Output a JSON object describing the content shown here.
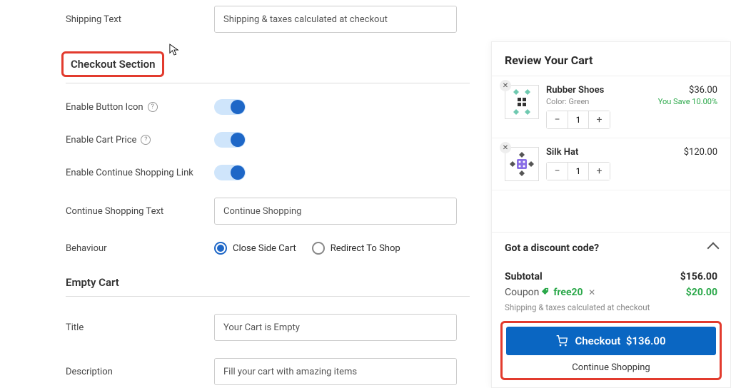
{
  "form": {
    "shipping_text_label": "Shipping Text",
    "shipping_text_value": "Shipping & taxes calculated at checkout",
    "checkout_section_heading": "Checkout Section",
    "enable_button_icon_label": "Enable Button Icon",
    "enable_cart_price_label": "Enable Cart Price",
    "enable_continue_shopping_label": "Enable Continue Shopping Link",
    "continue_shopping_text_label": "Continue Shopping Text",
    "continue_shopping_text_value": "Continue Shopping",
    "behaviour_label": "Behaviour",
    "behaviour_options": {
      "close": "Close Side Cart",
      "redirect": "Redirect To Shop"
    },
    "empty_cart_heading": "Empty Cart",
    "empty_title_label": "Title",
    "empty_title_value": "Your Cart is Empty",
    "empty_desc_label": "Description",
    "empty_desc_value": "Fill your cart with amazing items"
  },
  "cart": {
    "review_heading": "Review Your Cart",
    "items": [
      {
        "name": "Rubber Shoes",
        "meta": "Color: Green",
        "qty": "1",
        "price": "$36.00",
        "save": "You Save 10.00%"
      },
      {
        "name": "Silk Hat",
        "meta": "",
        "qty": "1",
        "price": "$120.00",
        "save": ""
      }
    ],
    "discount_prompt": "Got a discount code?",
    "subtotal_label": "Subtotal",
    "subtotal_value": "$156.00",
    "coupon_label": "Coupon",
    "coupon_code": "free20",
    "coupon_value": "$20.00",
    "ship_note": "Shipping & taxes calculated at checkout",
    "checkout_label": "Checkout",
    "checkout_total": "$136.00",
    "continue_shopping": "Continue Shopping"
  }
}
